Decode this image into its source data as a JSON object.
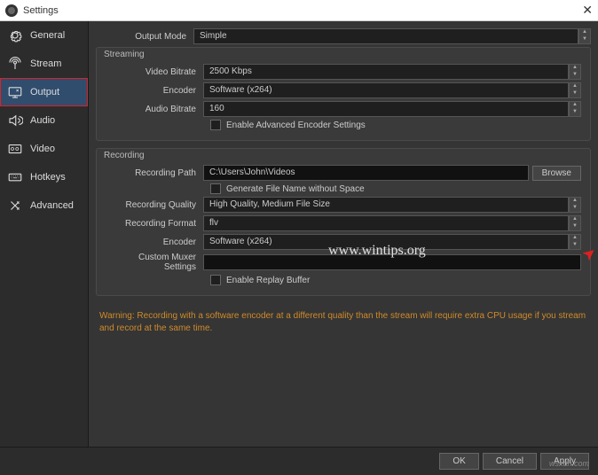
{
  "window": {
    "title": "Settings"
  },
  "sidebar": {
    "items": [
      {
        "label": "General"
      },
      {
        "label": "Stream"
      },
      {
        "label": "Output"
      },
      {
        "label": "Audio"
      },
      {
        "label": "Video"
      },
      {
        "label": "Hotkeys"
      },
      {
        "label": "Advanced"
      }
    ]
  },
  "output": {
    "mode_label": "Output Mode",
    "mode_value": "Simple"
  },
  "streaming": {
    "title": "Streaming",
    "video_bitrate_label": "Video Bitrate",
    "video_bitrate_value": "2500 Kbps",
    "encoder_label": "Encoder",
    "encoder_value": "Software (x264)",
    "audio_bitrate_label": "Audio Bitrate",
    "audio_bitrate_value": "160",
    "advanced_label": "Enable Advanced Encoder Settings"
  },
  "recording": {
    "title": "Recording",
    "path_label": "Recording Path",
    "path_value": "C:\\Users\\John\\Videos",
    "browse_label": "Browse",
    "gen_filename_label": "Generate File Name without Space",
    "quality_label": "Recording Quality",
    "quality_value": "High Quality, Medium File Size",
    "format_label": "Recording Format",
    "format_value": "flv",
    "encoder_label": "Encoder",
    "encoder_value": "Software (x264)",
    "muxer_label": "Custom Muxer Settings",
    "muxer_value": "",
    "replay_label": "Enable Replay Buffer"
  },
  "warning": "Warning: Recording with a software encoder at a different quality than the stream will require extra CPU usage if you stream and record at the same time.",
  "footer": {
    "ok": "OK",
    "cancel": "Cancel",
    "apply": "Apply"
  },
  "watermark": "www.wintips.org",
  "watermark2": "wsxdn.com"
}
